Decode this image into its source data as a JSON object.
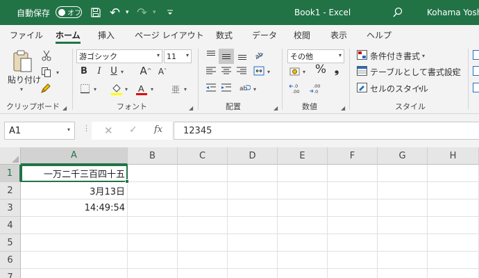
{
  "title_bar": {
    "autosave_label": "自動保存",
    "autosave_state": "オフ",
    "undo_glyph": "↶",
    "redo_glyph": "↷",
    "doc_title": "Book1 - Excel",
    "user_name": "Kohama Yosh"
  },
  "tabs": [
    {
      "label": "ファイル"
    },
    {
      "label": "ホーム",
      "active": true
    },
    {
      "label": "挿入"
    },
    {
      "label": "ページ レイアウト"
    },
    {
      "label": "数式"
    },
    {
      "label": "データ"
    },
    {
      "label": "校閲"
    },
    {
      "label": "表示"
    },
    {
      "label": "ヘルプ"
    }
  ],
  "ribbon": {
    "clipboard": {
      "label": "クリップボード",
      "paste_label": "貼り付け",
      "paste_arrow": "▾"
    },
    "font": {
      "label": "フォント",
      "font_name": "游ゴシック",
      "font_size": "11",
      "bold": "B",
      "italic": "I",
      "underline": "U",
      "grow": "A",
      "shrink": "A",
      "phonetic": "亜",
      "fill_color": "#ffff00",
      "font_color": "#e00000"
    },
    "alignment": {
      "label": "配置"
    },
    "number": {
      "label": "数値",
      "format": "その他",
      "percent": "%",
      "comma": "❟"
    },
    "styles": {
      "label": "スタイル",
      "conditional": "条件付き書式",
      "table": "テーブルとして書式設定",
      "cell_styles": "セルのスタイル"
    }
  },
  "formula_bar": {
    "name_box": "A1",
    "fx": "fx",
    "value": "12345"
  },
  "grid": {
    "columns": [
      "A",
      "B",
      "C",
      "D",
      "E",
      "F",
      "G",
      "H"
    ],
    "rows": [
      "1",
      "2",
      "3",
      "4",
      "5",
      "6",
      "7"
    ],
    "active_cell": "A1",
    "cells": {
      "A1": "一万二千三百四十五",
      "A2": "3月13日",
      "A3": "14:49:54"
    }
  }
}
